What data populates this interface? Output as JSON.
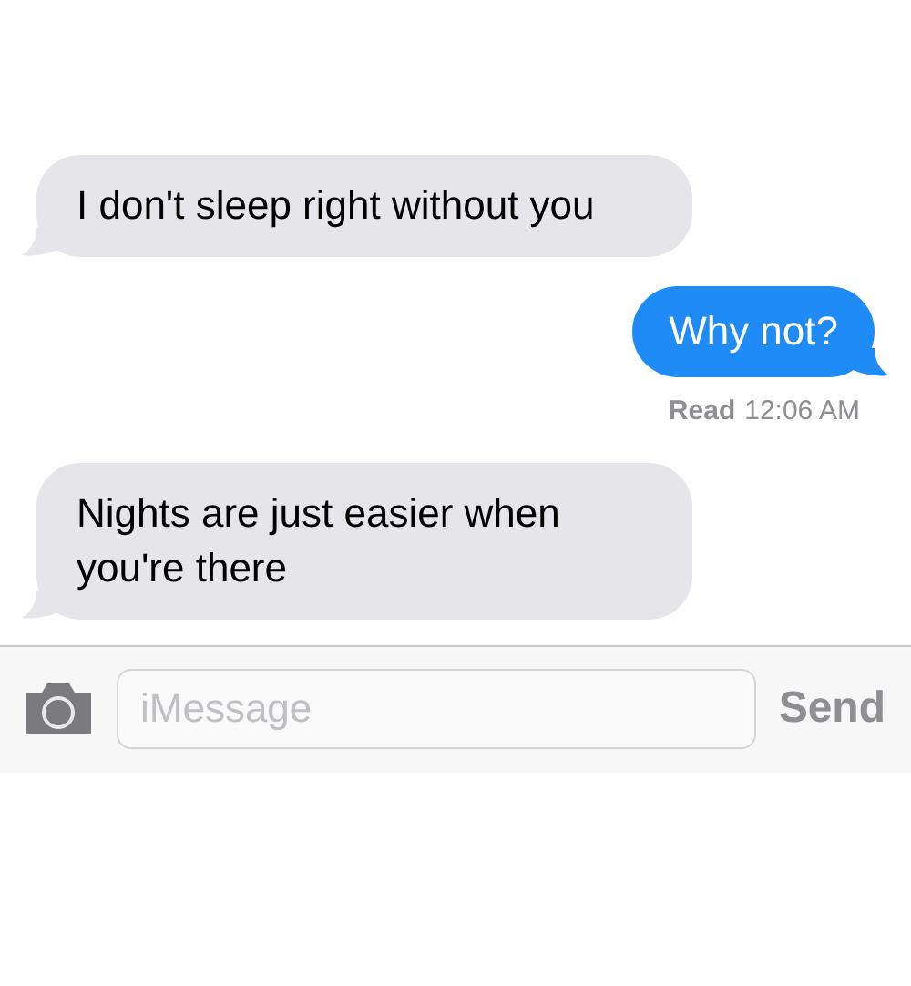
{
  "messages": [
    {
      "kind": "received",
      "text": "I don't sleep right without you"
    },
    {
      "kind": "sent",
      "text": "Why not?",
      "receipt_label": "Read",
      "receipt_time": "12:06 AM"
    },
    {
      "kind": "received",
      "text": "Nights are just easier when you're there"
    }
  ],
  "composer": {
    "placeholder": "iMessage",
    "send": "Send"
  }
}
